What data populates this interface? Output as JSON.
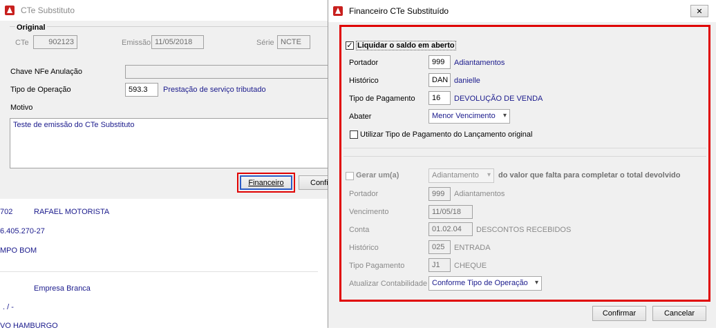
{
  "back_window": {
    "title": "CTe Substituto",
    "original_group": "Original",
    "cte_label": "CTe",
    "cte_value": "902123",
    "emissao_label": "Emissão",
    "emissao_value": "11/05/2018",
    "serie_label": "Série",
    "serie_value": "NCTE",
    "chave_label": "Chave NFe Anulação",
    "tipo_operacao_label": "Tipo de Operação",
    "tipo_operacao_code": "593.3",
    "tipo_operacao_desc": "Prestação de serviço tributado",
    "motivo_label": "Motivo",
    "motivo_value": "Teste de emissão do CTe Substituto",
    "financeiro_button": "Financeiro",
    "confirmar_button_partial": "Confi"
  },
  "background_list": {
    "row1_code": "702",
    "row1_name": "RAFAEL MOTORISTA",
    "row2": "6.405.270-27",
    "row3": "MPO BOM",
    "row4_name": "Empresa Branca",
    "row5": ". /  -",
    "row6": "VO HAMBURGO"
  },
  "dialog": {
    "title": "Financeiro CTe Substituído",
    "close_glyph": "✕",
    "liquidar_label": "Liquidar o saldo em aberto",
    "portador_label": "Portador",
    "portador_code": "999",
    "portador_desc": "Adiantamentos",
    "historico_label": "Histórico",
    "historico_code": "DAN",
    "historico_desc": "danielle",
    "tipo_pagamento_label": "Tipo de Pagamento",
    "tipo_pagamento_code": "16",
    "tipo_pagamento_desc": "DEVOLUÇÃO DE VENDA",
    "abater_label": "Abater",
    "abater_value": "Menor Vencimento",
    "utilizar_label": "Utilizar Tipo de Pagamento do Lançamento original",
    "gerar_label": "Gerar um(a)",
    "gerar_value": "Adiantamento",
    "gerar_suffix": "do valor que falta para completar o total devolvido",
    "g_portador_label": "Portador",
    "g_portador_code": "999",
    "g_portador_desc": "Adiantamentos",
    "g_vencimento_label": "Vencimento",
    "g_vencimento_value": "11/05/18",
    "g_conta_label": "Conta",
    "g_conta_code": "01.02.04",
    "g_conta_desc": "DESCONTOS RECEBIDOS",
    "g_historico_label": "Histórico",
    "g_historico_code": "025",
    "g_historico_desc": "ENTRADA",
    "g_tipo_pag_label": "Tipo Pagamento",
    "g_tipo_pag_code": "J1",
    "g_tipo_pag_desc": "CHEQUE",
    "g_atualizar_label": "Atualizar Contabilidade",
    "g_atualizar_value": "Conforme Tipo de Operação",
    "confirmar_button": "Confirmar",
    "cancelar_button": "Cancelar"
  },
  "colors": {
    "highlight": "#e00000",
    "link_blue": "#1a1a8c"
  }
}
